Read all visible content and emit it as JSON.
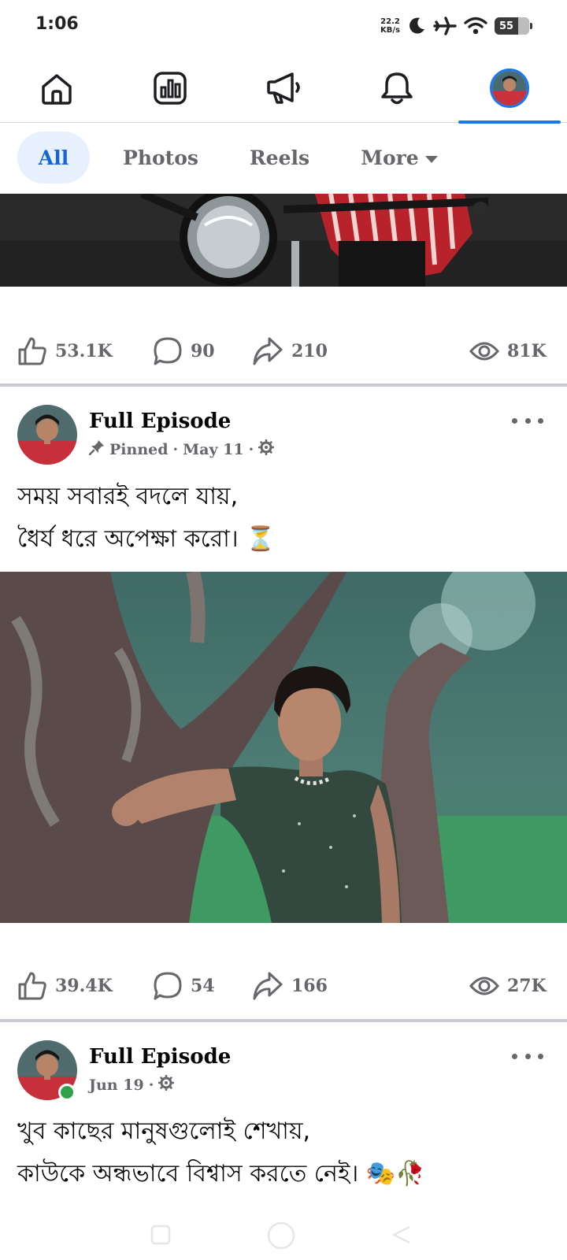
{
  "status_bar": {
    "time": "1:06",
    "net_speed_value": "22.2",
    "net_speed_unit": "KB/s",
    "battery": "55",
    "icons": [
      "moon-icon",
      "airplane-icon",
      "wifi-icon",
      "battery-icon"
    ]
  },
  "top_nav": {
    "items": [
      "home-icon",
      "dashboard-icon",
      "megaphone-icon",
      "bell-icon",
      "profile-avatar"
    ],
    "active_index": 4,
    "accent": "#1877f2"
  },
  "filters": {
    "chips": [
      {
        "label": "All",
        "active": true
      },
      {
        "label": "Photos",
        "active": false
      },
      {
        "label": "Reels",
        "active": false
      },
      {
        "label": "More",
        "active": false
      }
    ]
  },
  "post1": {
    "likes": "53.1K",
    "comments": "90",
    "shares": "210",
    "views": "81K"
  },
  "post2": {
    "page_name": "Full Episode",
    "pinned_label": "Pinned",
    "date": "May 11",
    "text_line1": "সময় সবারই বদলে যায়,",
    "text_line2": "ধৈর্য ধরে অপেক্ষা করো। ⏳",
    "likes": "39.4K",
    "comments": "54",
    "shares": "166",
    "views": "27K"
  },
  "post3": {
    "page_name": "Full Episode",
    "date": "Jun 19",
    "text_line1": "খুব কাছের মানুষগুলোই শেখায়,",
    "text_line2": "কাউকে অন্ধভাবে বিশ্বাস করতে নেই। 🎭🥀"
  },
  "colors": {
    "accent": "#1877f2",
    "secondary_text": "#65676b",
    "online": "#31a24c"
  }
}
